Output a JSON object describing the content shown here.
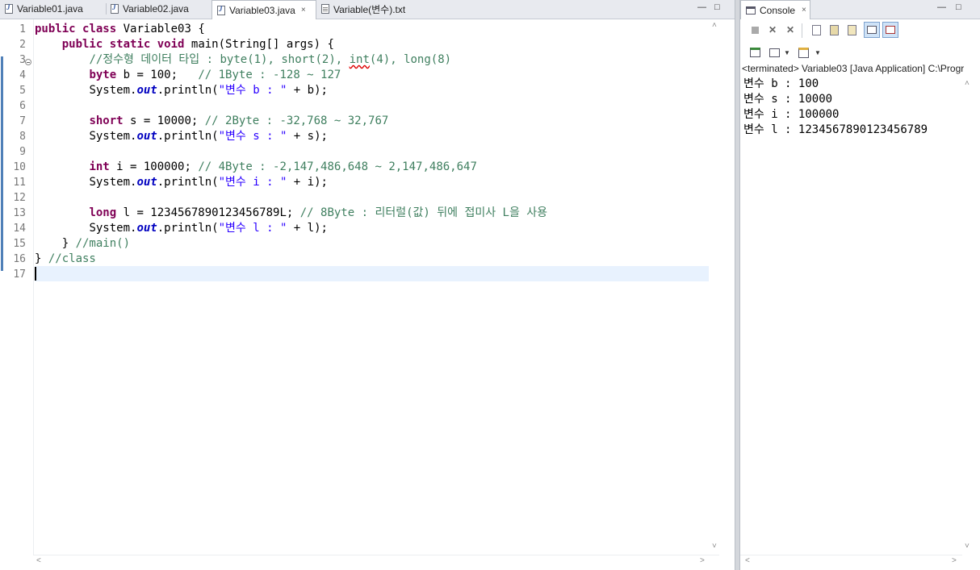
{
  "editor": {
    "tabs": [
      {
        "label": "Variable01.java",
        "type": "java"
      },
      {
        "label": "Variable02.java",
        "type": "java"
      },
      {
        "label": "Variable03.java",
        "type": "java"
      },
      {
        "label": "Variable(변수).txt",
        "type": "txt"
      }
    ],
    "active_tab": "Variable03.java",
    "line_numbers": [
      "1",
      "2",
      "3",
      "4",
      "5",
      "6",
      "7",
      "8",
      "9",
      "10",
      "11",
      "12",
      "13",
      "14",
      "15",
      "16",
      "17"
    ],
    "code": {
      "l1_kw1": "public",
      "l1_kw2": "class",
      "l1_rest": " Variable03 {",
      "l2_kw1": "public",
      "l2_kw2": "static",
      "l2_kw3": "void",
      "l2_rest": " main(String[] args) {",
      "l3_cm_a": "//정수형 데이터 타입 : byte(1), short(2), ",
      "l3_cm_int": "int",
      "l3_cm_b": "(4), long(8)",
      "l4_kw": "byte",
      "l4_rest": " b = 100;   ",
      "l4_cm": "// 1Byte : -128 ~ 127",
      "l5_pre": "System.",
      "l5_fld": "out",
      "l5_mid": ".println(",
      "l5_str": "\"변수 b : \"",
      "l5_post": " + b);",
      "l7_kw": "short",
      "l7_rest": " s = 10000; ",
      "l7_cm": "// 2Byte : -32,768 ~ 32,767",
      "l8_pre": "System.",
      "l8_fld": "out",
      "l8_mid": ".println(",
      "l8_str": "\"변수 s : \"",
      "l8_post": " + s);",
      "l10_kw": "int",
      "l10_rest": " i = 100000; ",
      "l10_cm": "// 4Byte : -2,147,486,648 ~ 2,147,486,647",
      "l11_pre": "System.",
      "l11_fld": "out",
      "l11_mid": ".println(",
      "l11_str": "\"변수 i : \"",
      "l11_post": " + i);",
      "l13_kw": "long",
      "l13_rest": " l = 1234567890123456789L; ",
      "l13_cm": "// 8Byte : 리터럴(값) 뒤에 접미사 L을 사용",
      "l14_pre": "System.",
      "l14_fld": "out",
      "l14_mid": ".println(",
      "l14_str": "\"변수 l : \"",
      "l14_post": " + l);",
      "l15_rest": "} ",
      "l15_cm": "//main()",
      "l16_rest": "} ",
      "l16_cm": "//class"
    }
  },
  "console": {
    "tab_label": "Console",
    "status": "<terminated> Variable03 [Java Application] C:\\Progr",
    "output": [
      "변수 b : 100",
      "변수 s : 10000",
      "변수 i : 100000",
      "변수 l : 1234567890123456789"
    ]
  },
  "icons": {
    "close": "×",
    "minimize": "—",
    "maximize": "□",
    "scroll_up": "˄",
    "scroll_down": "˅",
    "scroll_left": "˂",
    "scroll_right": "˃"
  },
  "colors": {
    "keyword": "#7f0055",
    "comment": "#3f7f5f",
    "string": "#2a00ff",
    "field": "#0000c0",
    "current_line": "#e8f2fe"
  }
}
